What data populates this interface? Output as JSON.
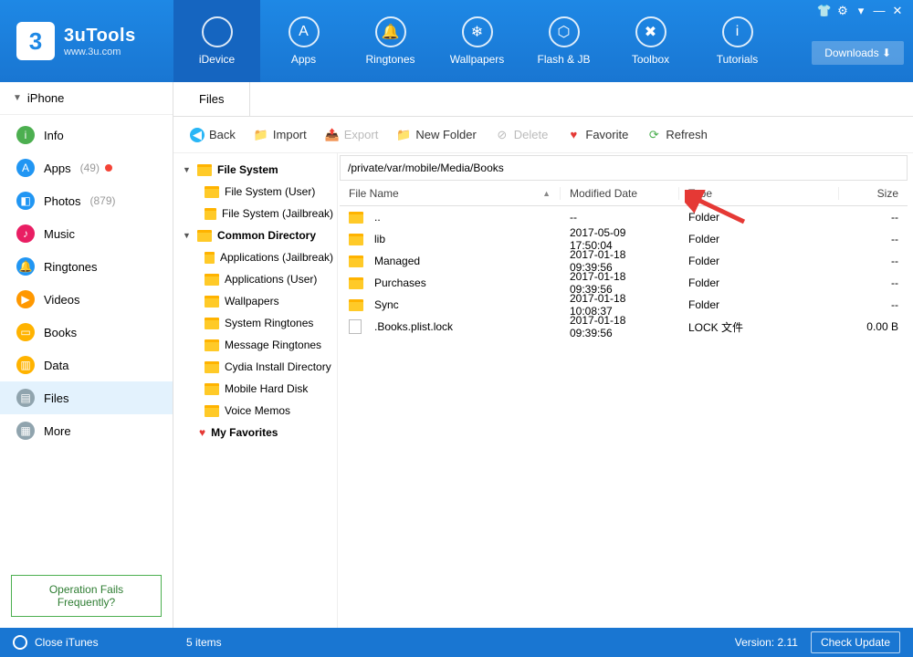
{
  "brand": {
    "name": "3uTools",
    "site": "www.3u.com"
  },
  "downloads_label": "Downloads",
  "topnav": [
    {
      "label": "iDevice",
      "glyph": "",
      "selected": true
    },
    {
      "label": "Apps",
      "glyph": "A"
    },
    {
      "label": "Ringtones",
      "glyph": "🔔"
    },
    {
      "label": "Wallpapers",
      "glyph": "❄"
    },
    {
      "label": "Flash & JB",
      "glyph": "⬡"
    },
    {
      "label": "Toolbox",
      "glyph": "✖"
    },
    {
      "label": "Tutorials",
      "glyph": "i"
    }
  ],
  "device_name": "iPhone",
  "sidebar": [
    {
      "label": "Info",
      "color": "#4caf50",
      "glyph": "i"
    },
    {
      "label": "Apps",
      "color": "#2196f3",
      "glyph": "A",
      "count": "(49)",
      "dot": true
    },
    {
      "label": "Photos",
      "color": "#2196f3",
      "glyph": "◧",
      "count": "(879)"
    },
    {
      "label": "Music",
      "color": "#e91e63",
      "glyph": "♪"
    },
    {
      "label": "Ringtones",
      "color": "#2196f3",
      "glyph": "🔔"
    },
    {
      "label": "Videos",
      "color": "#ff9800",
      "glyph": "▶"
    },
    {
      "label": "Books",
      "color": "#ffb300",
      "glyph": "▭"
    },
    {
      "label": "Data",
      "color": "#ffb300",
      "glyph": "▥"
    },
    {
      "label": "Files",
      "color": "#90a4ae",
      "glyph": "▤",
      "selected": true
    },
    {
      "label": "More",
      "color": "#90a4ae",
      "glyph": "▦"
    }
  ],
  "op_fail": "Operation Fails Frequently?",
  "tab_label": "Files",
  "toolbar": {
    "back": "Back",
    "import": "Import",
    "export": "Export",
    "new_folder": "New Folder",
    "delete": "Delete",
    "favorite": "Favorite",
    "refresh": "Refresh"
  },
  "tree": {
    "groups": [
      {
        "label": "File System",
        "children": [
          "File System (User)",
          "File System (Jailbreak)"
        ]
      },
      {
        "label": "Common Directory",
        "children": [
          "Applications (Jailbreak)",
          "Applications (User)",
          "Wallpapers",
          "System Ringtones",
          "Message Ringtones",
          "Cydia Install Directory",
          "Mobile Hard Disk",
          "Voice Memos"
        ]
      }
    ],
    "favorites": "My Favorites"
  },
  "path": "/private/var/mobile/Media/Books",
  "columns": {
    "name": "File Name",
    "date": "Modified Date",
    "type": "Type",
    "size": "Size"
  },
  "rows": [
    {
      "name": "..",
      "date": "--",
      "type": "Folder",
      "size": "--",
      "kind": "folder"
    },
    {
      "name": "lib",
      "date": "2017-05-09 17:50:04",
      "type": "Folder",
      "size": "--",
      "kind": "folder"
    },
    {
      "name": "Managed",
      "date": "2017-01-18 09:39:56",
      "type": "Folder",
      "size": "--",
      "kind": "folder"
    },
    {
      "name": "Purchases",
      "date": "2017-01-18 09:39:56",
      "type": "Folder",
      "size": "--",
      "kind": "folder"
    },
    {
      "name": "Sync",
      "date": "2017-01-18 10:08:37",
      "type": "Folder",
      "size": "--",
      "kind": "folder"
    },
    {
      "name": ".Books.plist.lock",
      "date": "2017-01-18 09:39:56",
      "type": "LOCK 文件",
      "size": "0.00 B",
      "kind": "file"
    }
  ],
  "statusbar": {
    "close_itunes": "Close iTunes",
    "items": "5 items",
    "version": "Version: 2.11",
    "check_update": "Check Update"
  }
}
